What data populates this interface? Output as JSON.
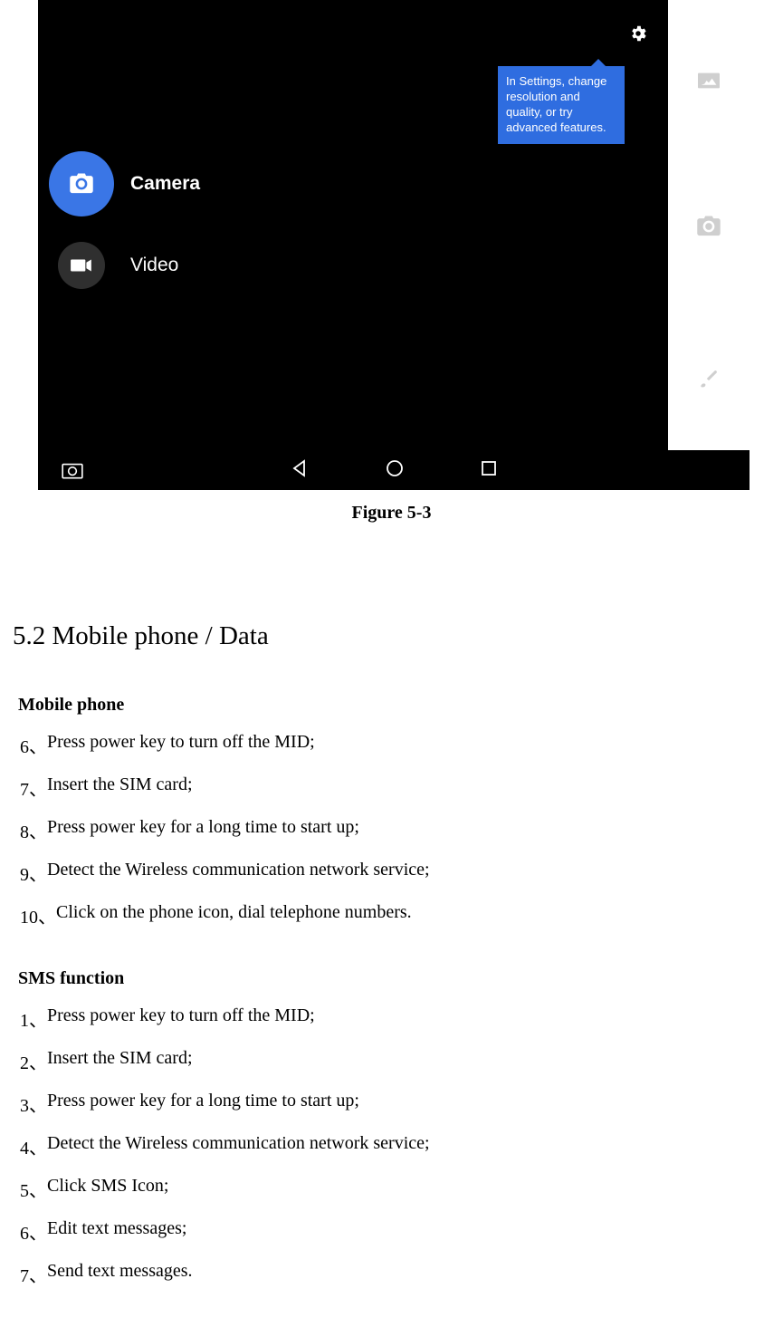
{
  "screenshot": {
    "tooltip_text": "In Settings, change resolution and quality, or try advanced features.",
    "mode_camera_label": "Camera",
    "mode_video_label": "Video"
  },
  "figure_caption": "Figure 5-3",
  "section_heading": "5.2 Mobile phone / Data",
  "mobile_phone": {
    "title": "Mobile phone",
    "items": [
      {
        "num": "6、",
        "text": "Press power key to turn off the MID;"
      },
      {
        "num": "7、",
        "text": "Insert the SIM card;"
      },
      {
        "num": "8、",
        "text": "Press power key for a long time to start up;"
      },
      {
        "num": "9、",
        "text": "Detect the Wireless communication network service;"
      },
      {
        "num": "10、",
        "text": "Click on the phone icon, dial telephone numbers."
      }
    ]
  },
  "sms_function": {
    "title": "SMS function",
    "items": [
      {
        "num": "1、",
        "text": "Press power key to turn off the MID;"
      },
      {
        "num": "2、",
        "text": "Insert the SIM card;"
      },
      {
        "num": "3、",
        "text": "Press power key for a long time to start up;"
      },
      {
        "num": "4、",
        "text": "Detect the Wireless communication network service;"
      },
      {
        "num": "5、",
        "text": "Click SMS Icon;"
      },
      {
        "num": "6、",
        "text": "Edit text messages;"
      },
      {
        "num": "7、",
        "text": "Send text messages."
      }
    ]
  }
}
